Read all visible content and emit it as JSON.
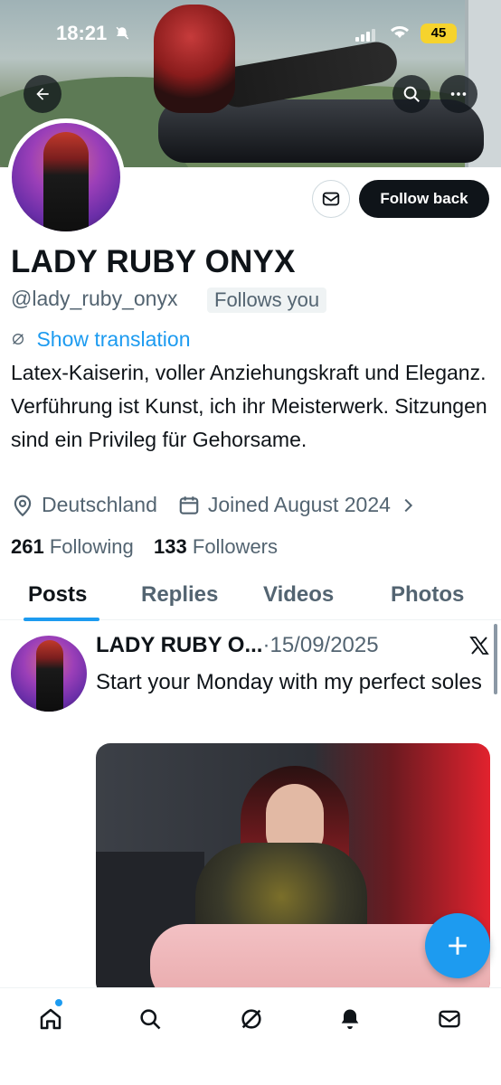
{
  "status_bar": {
    "time": "18:21",
    "battery": "45"
  },
  "profile": {
    "name": "LADY RUBY ONYX",
    "handle": "@lady_ruby_onyx",
    "follows_you": "Follows you",
    "show_translation": "Show translation",
    "bio": "Latex-Kaiserin, voller Anziehungskraft und Eleganz. Verführung ist Kunst, ich ihr Meisterwerk. Sitzungen sind ein Privileg für Gehorsame.",
    "location": "Deutschland",
    "joined": "Joined August 2024",
    "following_count": "261",
    "following_label": "Following",
    "followers_count": "133",
    "followers_label": "Followers"
  },
  "actions": {
    "follow_back": "Follow back"
  },
  "tabs": [
    {
      "label": "Posts",
      "active": true
    },
    {
      "label": "Replies",
      "active": false
    },
    {
      "label": "Videos",
      "active": false
    },
    {
      "label": "Photos",
      "active": false
    }
  ],
  "post": {
    "author": "LADY RUBY O...",
    "separator": "·",
    "date": "15/09/2025",
    "text": "Start your Monday with my perfect soles",
    "source_icon": "x-logo-icon"
  },
  "colors": {
    "accent": "#1d9bf0",
    "text_primary": "#0f1419",
    "text_secondary": "#536471",
    "battery": "#f6d32d"
  },
  "icons": {
    "back": "arrow-left-icon",
    "search": "search-icon",
    "more": "more-icon",
    "message": "envelope-icon",
    "location": "location-pin-icon",
    "calendar": "calendar-icon",
    "compose": "plus-icon",
    "nav": [
      "home-icon",
      "search-icon",
      "grok-icon",
      "bell-icon",
      "envelope-icon"
    ]
  }
}
